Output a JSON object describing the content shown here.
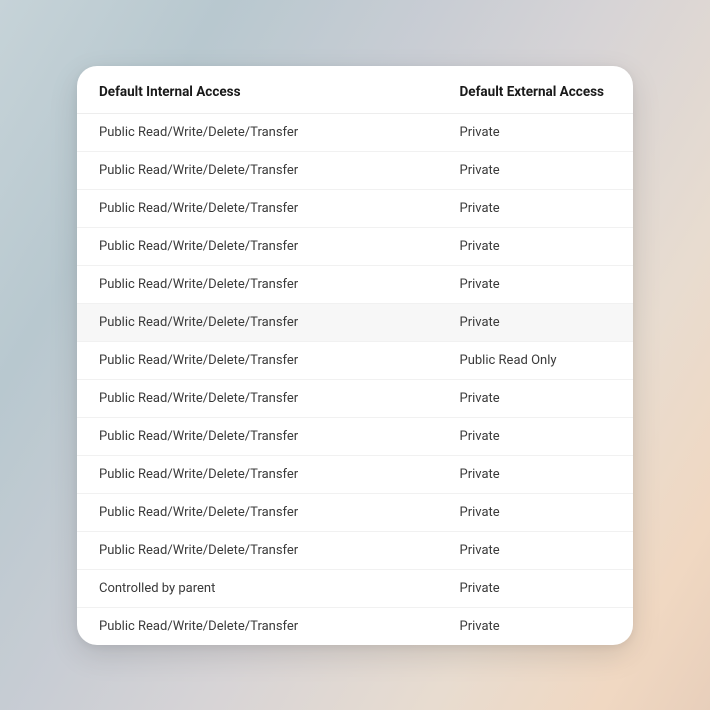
{
  "table": {
    "headers": {
      "internal": "Default Internal Access",
      "external": "Default External Access"
    },
    "rows": [
      {
        "internal": "Public Read/Write/Delete/Transfer",
        "external": "Private",
        "highlight": false
      },
      {
        "internal": "Public Read/Write/Delete/Transfer",
        "external": "Private",
        "highlight": false
      },
      {
        "internal": "Public Read/Write/Delete/Transfer",
        "external": "Private",
        "highlight": false
      },
      {
        "internal": "Public Read/Write/Delete/Transfer",
        "external": "Private",
        "highlight": false
      },
      {
        "internal": "Public Read/Write/Delete/Transfer",
        "external": "Private",
        "highlight": false
      },
      {
        "internal": "Public Read/Write/Delete/Transfer",
        "external": "Private",
        "highlight": true
      },
      {
        "internal": "Public Read/Write/Delete/Transfer",
        "external": "Public Read Only",
        "highlight": false
      },
      {
        "internal": "Public Read/Write/Delete/Transfer",
        "external": "Private",
        "highlight": false
      },
      {
        "internal": "Public Read/Write/Delete/Transfer",
        "external": "Private",
        "highlight": false
      },
      {
        "internal": "Public Read/Write/Delete/Transfer",
        "external": "Private",
        "highlight": false
      },
      {
        "internal": "Public Read/Write/Delete/Transfer",
        "external": "Private",
        "highlight": false
      },
      {
        "internal": "Public Read/Write/Delete/Transfer",
        "external": "Private",
        "highlight": false
      },
      {
        "internal": "Controlled by parent",
        "external": "Private",
        "highlight": false
      },
      {
        "internal": "Public Read/Write/Delete/Transfer",
        "external": "Private",
        "highlight": false
      }
    ]
  }
}
